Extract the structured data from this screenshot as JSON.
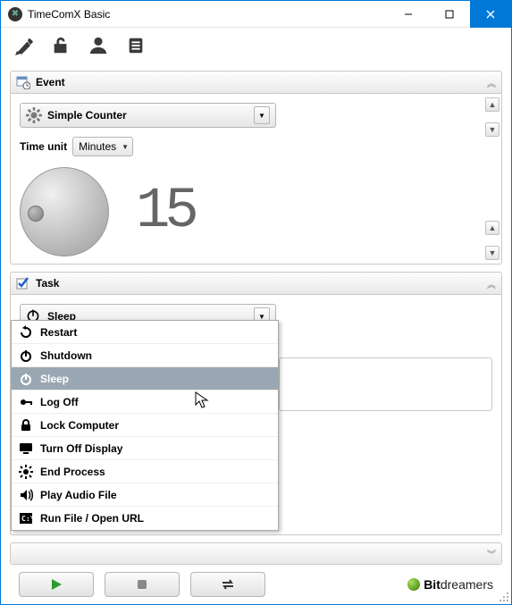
{
  "window": {
    "title": "TimeComX Basic"
  },
  "sections": {
    "event": {
      "title": "Event"
    },
    "task": {
      "title": "Task"
    }
  },
  "event": {
    "mode": "Simple Counter",
    "time_unit_label": "Time unit",
    "time_unit_value": "Minutes",
    "counter_value": "15"
  },
  "task": {
    "selected": "Sleep",
    "options": [
      "Restart",
      "Shutdown",
      "Sleep",
      "Log Off",
      "Lock Computer",
      "Turn Off Display",
      "End Process",
      "Play Audio File",
      "Run File / Open URL"
    ]
  },
  "brand": {
    "bold": "Bit",
    "rest": "dreamers"
  }
}
